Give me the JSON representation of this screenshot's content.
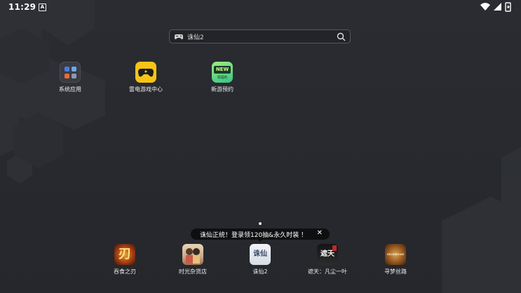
{
  "status_bar": {
    "time": "11:29",
    "notification_glyph": "A",
    "icons": [
      "wifi-icon",
      "signal-icon",
      "battery-icon"
    ]
  },
  "search": {
    "value": "诛仙2",
    "icon_left": "gamepad-icon",
    "icon_right": "search-icon"
  },
  "apps": [
    {
      "label": "系统应用",
      "icon": "folder-icon"
    },
    {
      "label": "雷电游戏中心",
      "icon": "gamepad-icon"
    },
    {
      "label": "新游预约",
      "icon": "new-badge-icon",
      "badge_text": "NEW",
      "sub_text": "领福利"
    }
  ],
  "page_indicator": {
    "pages": 1,
    "current": 1
  },
  "tooltip": {
    "text": "诛仙正统！登录领120抽&永久时装 ！",
    "close": "✕"
  },
  "dock": [
    {
      "label": "吞食之刃",
      "icon": "blade-game-icon",
      "glyph": "刃"
    },
    {
      "label": "时光杂货店",
      "icon": "shop-game-icon",
      "glyph": ""
    },
    {
      "label": "诛仙2",
      "icon": "zhuxian-game-icon",
      "glyph": "诛仙"
    },
    {
      "label": "遮天：凡尘一叶",
      "icon": "zhetian-game-icon",
      "glyph": "遮天"
    },
    {
      "label": "寻梦丝路",
      "icon": "silkroad-game-icon",
      "glyph": "SILKROAD"
    }
  ],
  "colors": {
    "background": "#26282d",
    "accent_yellow": "#f6c416",
    "tooltip_bg": "#0e0f10"
  }
}
